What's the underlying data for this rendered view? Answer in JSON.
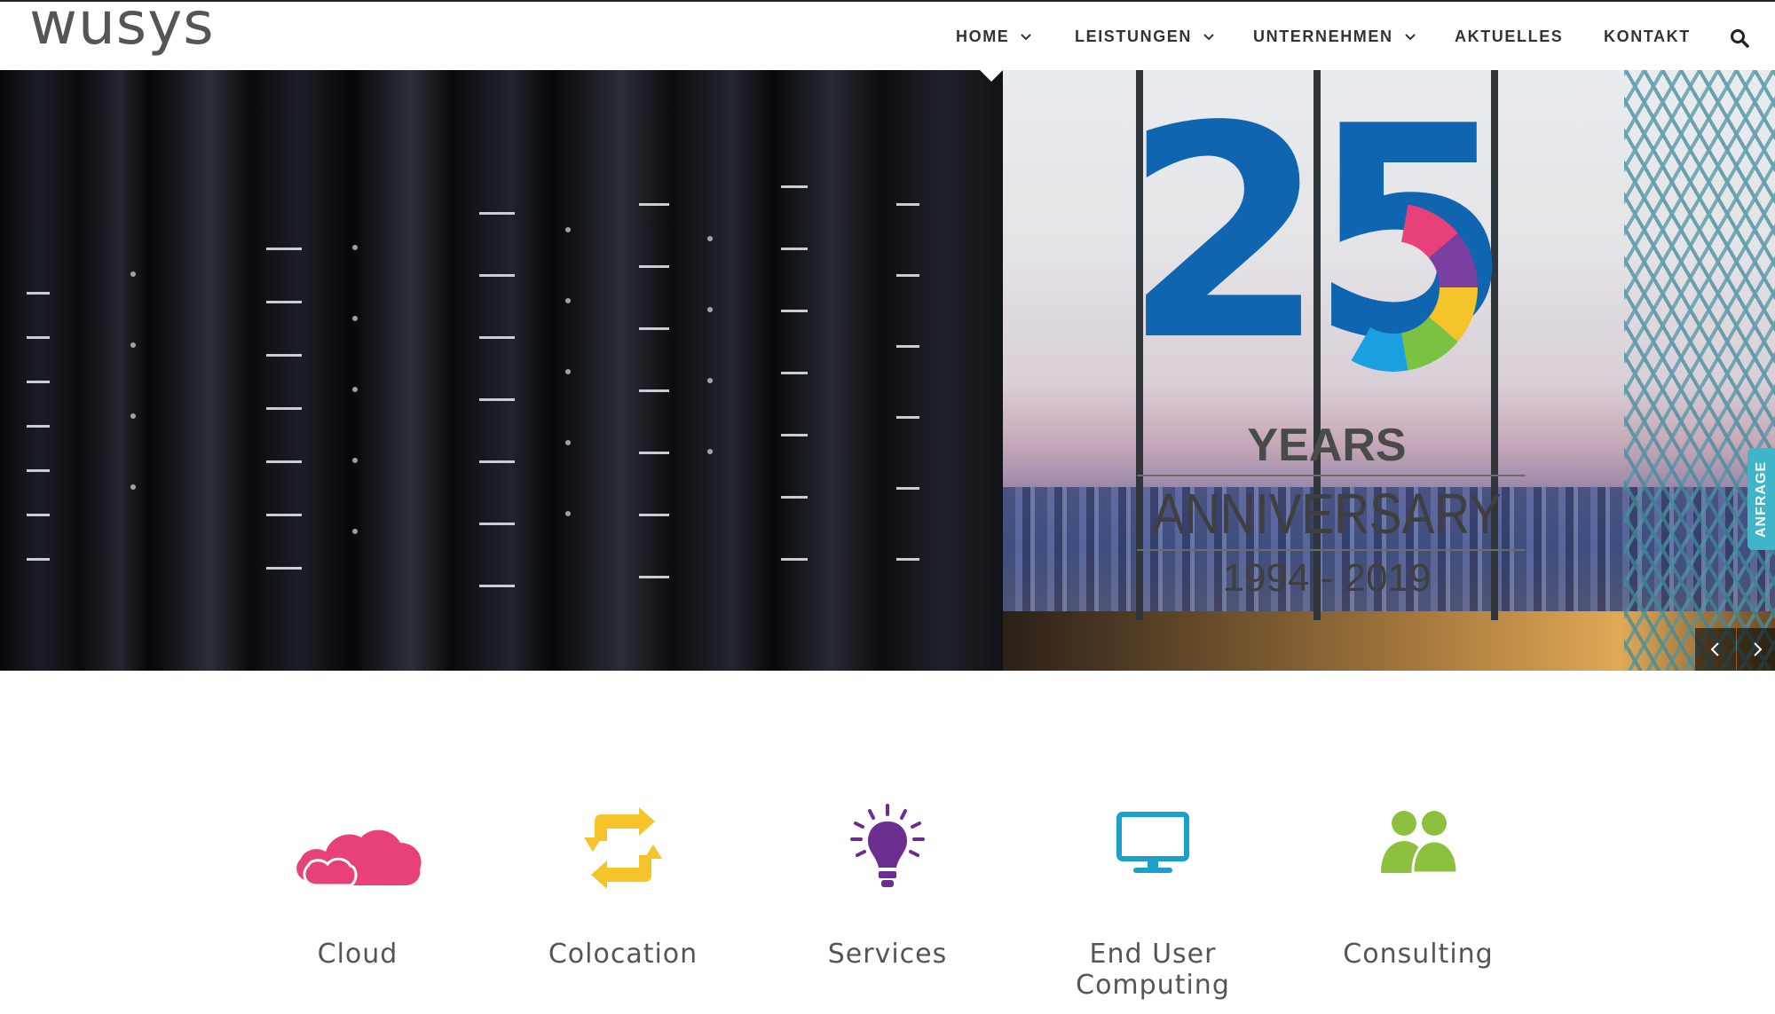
{
  "brand": {
    "logo_text": "wusys"
  },
  "nav": {
    "items": [
      {
        "label": "HOME",
        "has_dropdown": true,
        "active": true
      },
      {
        "label": "LEISTUNGEN",
        "has_dropdown": true
      },
      {
        "label": "UNTERNEHMEN",
        "has_dropdown": true
      },
      {
        "label": "AKTUELLES",
        "has_dropdown": false
      },
      {
        "label": "KONTAKT",
        "has_dropdown": false
      }
    ],
    "search_icon": "search-icon"
  },
  "hero": {
    "badge_number": "25",
    "badge_line_1": "YEARS",
    "badge_line_2": "ANNIVERSARY",
    "badge_line_3": "1994 - 2019",
    "badge_color": "#0f65b0",
    "ring_colors": [
      "#e8417a",
      "#7a3fa0",
      "#f4c42a",
      "#7cc242",
      "#1aa0e0"
    ],
    "side_tab_label": "ANFRAGE",
    "side_tab_color": "#3fb5c9",
    "prev_icon": "chevron-left-icon",
    "next_icon": "chevron-right-icon"
  },
  "services": [
    {
      "label": "Cloud",
      "icon": "cloud-icon",
      "color": "#e8417a"
    },
    {
      "label": "Colocation",
      "icon": "refresh-icon",
      "color": "#f4c42a"
    },
    {
      "label": "Services",
      "icon": "lightbulb-icon",
      "color": "#6b2d8f"
    },
    {
      "label": "End User Computing",
      "icon": "monitor-icon",
      "color": "#1aa0cf"
    },
    {
      "label": "Consulting",
      "icon": "users-icon",
      "color": "#8cc13f"
    }
  ]
}
